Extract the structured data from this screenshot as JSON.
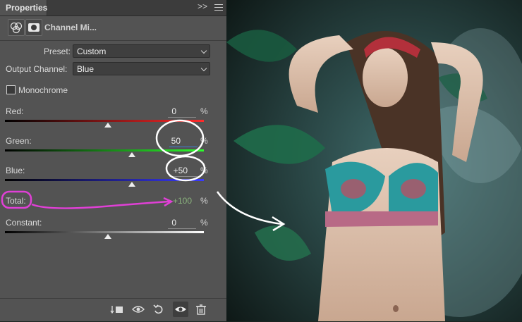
{
  "panel": {
    "tab_label": "Properties",
    "collapse_glyph": ">>",
    "title": "Channel Mi..."
  },
  "preset": {
    "label": "Preset:",
    "value": "Custom"
  },
  "output_channel": {
    "label": "Output Channel:",
    "value": "Blue"
  },
  "monochrome": {
    "label": "Monochrome",
    "checked": false
  },
  "sliders": {
    "red": {
      "label": "Red:",
      "value": "0",
      "unit": "%",
      "level": 0
    },
    "green": {
      "label": "Green:",
      "value": "50",
      "unit": "%",
      "level": 50
    },
    "blue": {
      "label": "Blue:",
      "value": "+50",
      "unit": "%",
      "level": 50
    }
  },
  "total": {
    "label": "Total:",
    "value": "+100",
    "unit": "%"
  },
  "constant": {
    "label": "Constant:",
    "value": "0",
    "unit": "%",
    "level": 0
  },
  "colors": {
    "panel_bg": "#535353",
    "annotation_magenta": "#e040d6",
    "annotation_white": "#ffffff",
    "total_value_green": "#89b17c"
  },
  "icons": [
    "channel-mixer-icon",
    "layer-mask-icon",
    "clip-to-layer-icon",
    "view-previous-icon",
    "reset-icon",
    "visibility-icon",
    "delete-icon"
  ]
}
